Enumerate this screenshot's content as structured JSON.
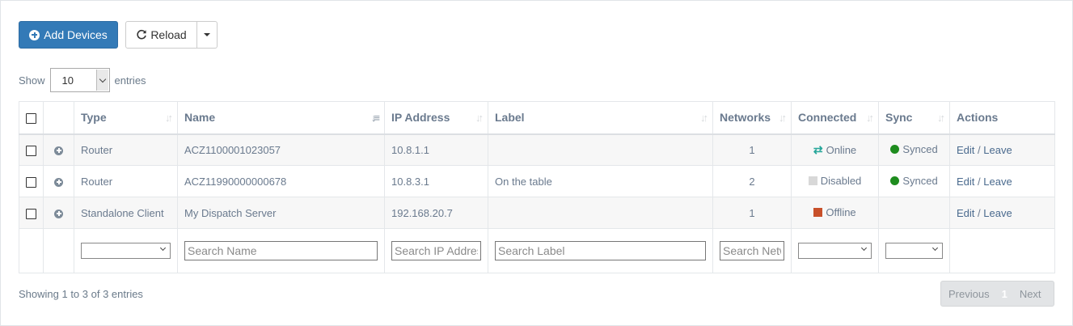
{
  "toolbar": {
    "add_label": "Add Devices",
    "reload_label": "Reload"
  },
  "length": {
    "show_label": "Show",
    "value": "10",
    "entries_label": "entries"
  },
  "table": {
    "headers": {
      "type": "Type",
      "name": "Name",
      "ip": "IP Address",
      "label": "Label",
      "networks": "Networks",
      "connected": "Connected",
      "sync": "Sync",
      "actions": "Actions"
    },
    "rows": [
      {
        "type": "Router",
        "name": "ACZ1100001023057",
        "ip": "10.8.1.1",
        "label": "",
        "networks": "1",
        "connected": "Online",
        "sync": "Synced",
        "edit": "Edit",
        "sep": "/",
        "leave": "Leave"
      },
      {
        "type": "Router",
        "name": "ACZ11990000000678",
        "ip": "10.8.3.1",
        "label": "On the table",
        "networks": "2",
        "connected": "Disabled",
        "sync": "Synced",
        "edit": "Edit",
        "sep": "/",
        "leave": "Leave"
      },
      {
        "type": "Standalone Client",
        "name": "My Dispatch Server",
        "ip": "192.168.20.7",
        "label": "",
        "networks": "1",
        "connected": "Offline",
        "sync": "",
        "edit": "Edit",
        "sep": "/",
        "leave": "Leave"
      }
    ],
    "search": {
      "name_placeholder": "Search Name",
      "ip_placeholder": "Search IP Address",
      "label_placeholder": "Search Label",
      "networks_placeholder": "Search Networks"
    }
  },
  "footer": {
    "info": "Showing 1 to 3 of 3 entries",
    "previous": "Previous",
    "page": "1",
    "next": "Next"
  },
  "colors": {
    "primary": "#337ab7",
    "online": "#26a69a",
    "disabled": "#d8d8d8",
    "offline": "#c8502a",
    "synced": "#1e8c1e"
  }
}
